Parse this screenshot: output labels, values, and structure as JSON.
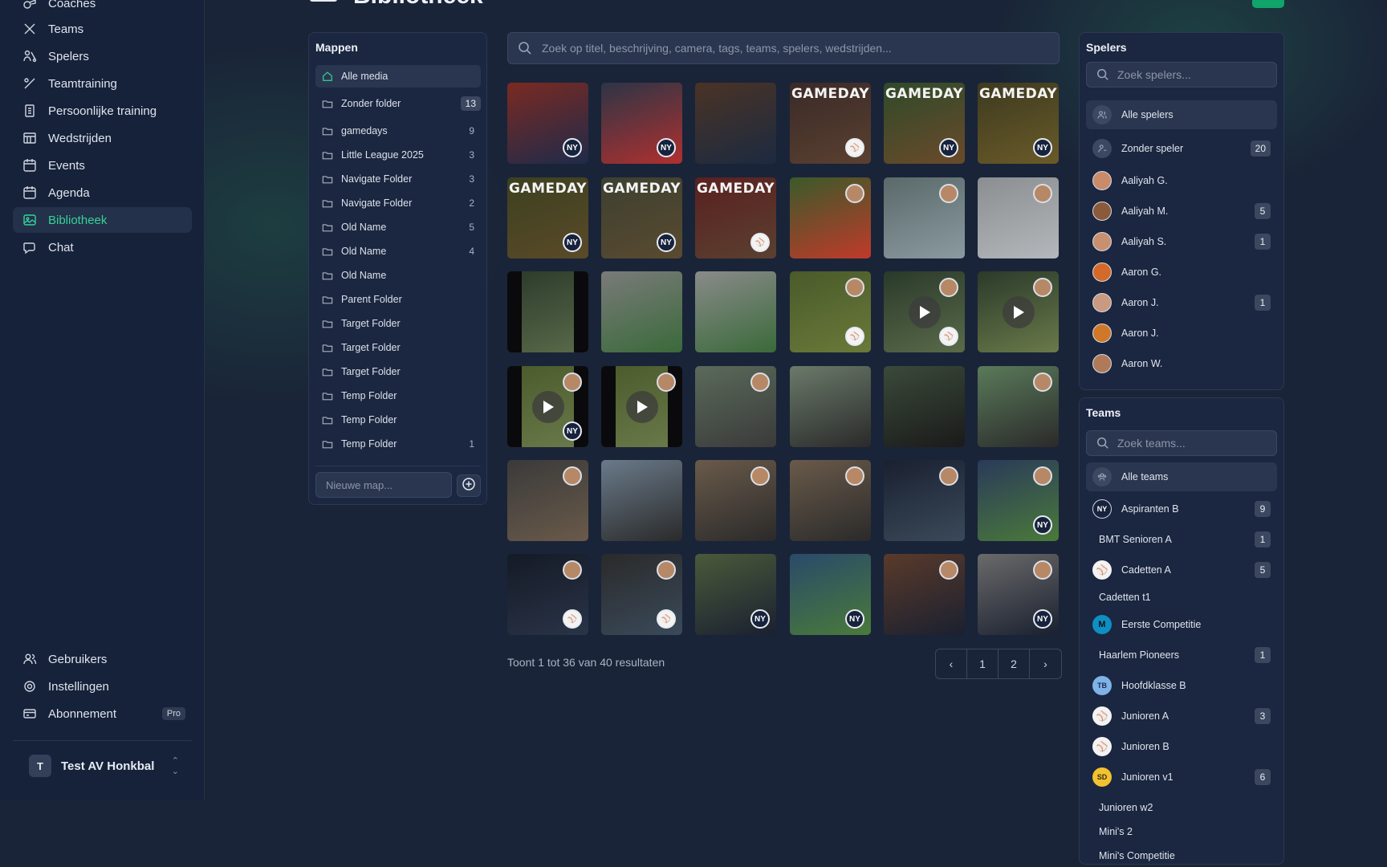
{
  "sidebar": {
    "items": [
      {
        "label": "Coaches",
        "icon": "whistle-icon"
      },
      {
        "label": "Teams",
        "icon": "crossed-bats-icon"
      },
      {
        "label": "Spelers",
        "icon": "players-icon"
      },
      {
        "label": "Teamtraining",
        "icon": "bat-ball-icon"
      },
      {
        "label": "Persoonlijke training",
        "icon": "clipboard-icon"
      },
      {
        "label": "Wedstrijden",
        "icon": "scoreboard-icon"
      },
      {
        "label": "Events",
        "icon": "calendar-icon"
      },
      {
        "label": "Agenda",
        "icon": "calendar-icon"
      },
      {
        "label": "Bibliotheek",
        "icon": "image-icon"
      },
      {
        "label": "Chat",
        "icon": "chat-icon"
      }
    ],
    "bottom": [
      {
        "label": "Gebruikers",
        "icon": "users-icon"
      },
      {
        "label": "Instellingen",
        "icon": "gear-icon"
      },
      {
        "label": "Abonnement",
        "icon": "card-icon",
        "badge": "Pro"
      }
    ],
    "org": {
      "initial": "T",
      "name": "Test AV Honkbal"
    }
  },
  "header": {
    "title": "Bibliotheek"
  },
  "folders": {
    "title": "Mappen",
    "items": [
      {
        "label": "Alle media",
        "count": ""
      },
      {
        "label": "Zonder folder",
        "count": "13"
      },
      {
        "label": "gamedays",
        "count": "9"
      },
      {
        "label": "Little League 2025",
        "count": "3"
      },
      {
        "label": "Navigate Folder",
        "count": "3"
      },
      {
        "label": "Navigate Folder",
        "count": "2"
      },
      {
        "label": "Old Name",
        "count": "5"
      },
      {
        "label": "Old Name",
        "count": "4"
      },
      {
        "label": "Old Name",
        "count": ""
      },
      {
        "label": "Parent Folder",
        "count": ""
      },
      {
        "label": "Target Folder",
        "count": ""
      },
      {
        "label": "Target Folder",
        "count": ""
      },
      {
        "label": "Target Folder",
        "count": ""
      },
      {
        "label": "Temp Folder",
        "count": ""
      },
      {
        "label": "Temp Folder",
        "count": ""
      },
      {
        "label": "Temp Folder",
        "count": "1"
      }
    ],
    "new_placeholder": "Nieuwe map..."
  },
  "search": {
    "placeholder": "Zoek op titel, beschrijving, camera, tags, teams, spelers, wedstrijden..."
  },
  "grid": {
    "gameday_label": "GAMEDAY"
  },
  "results": {
    "text": "Toont 1 tot 36 van 40 resultaten",
    "pages": [
      "1",
      "2"
    ]
  },
  "players": {
    "title": "Spelers",
    "placeholder": "Zoek spelers...",
    "items": [
      {
        "label": "Alle spelers",
        "count": ""
      },
      {
        "label": "Zonder speler",
        "count": "20"
      },
      {
        "label": "Aaliyah G.",
        "count": ""
      },
      {
        "label": "Aaliyah M.",
        "count": "5"
      },
      {
        "label": "Aaliyah S.",
        "count": "1"
      },
      {
        "label": "Aaron G.",
        "count": ""
      },
      {
        "label": "Aaron J.",
        "count": "1"
      },
      {
        "label": "Aaron J.",
        "count": ""
      },
      {
        "label": "Aaron W.",
        "count": ""
      }
    ]
  },
  "teams": {
    "title": "Teams",
    "placeholder": "Zoek teams...",
    "items": [
      {
        "label": "Alle teams",
        "count": ""
      },
      {
        "label": "Aspiranten B",
        "count": "9",
        "logo": "NY"
      },
      {
        "label": "BMT Senioren A",
        "count": "1",
        "logo": ""
      },
      {
        "label": "Cadetten A",
        "count": "5",
        "logo": "ball"
      },
      {
        "label": "Cadetten t1",
        "count": "",
        "logo": ""
      },
      {
        "label": "Eerste Competitie",
        "count": "",
        "logo": "M"
      },
      {
        "label": "Haarlem Pioneers",
        "count": "1",
        "logo": ""
      },
      {
        "label": "Hoofdklasse B",
        "count": "",
        "logo": "TB"
      },
      {
        "label": "Junioren A",
        "count": "3",
        "logo": "ball"
      },
      {
        "label": "Junioren B",
        "count": "",
        "logo": "ball"
      },
      {
        "label": "Junioren v1",
        "count": "6",
        "logo": "SD"
      },
      {
        "label": "Junioren w2",
        "count": "",
        "logo": ""
      },
      {
        "label": "Mini's 2",
        "count": "",
        "logo": ""
      },
      {
        "label": "Mini's Competitie",
        "count": "",
        "logo": ""
      }
    ]
  },
  "colors": {
    "accent": "#34d399",
    "background": "#1a2438",
    "sidebar": "#16213a",
    "cta": "#10a36a"
  }
}
